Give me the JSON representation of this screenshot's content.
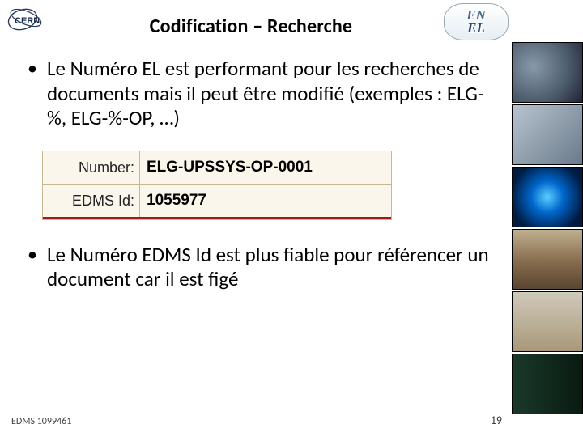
{
  "header": {
    "title": "Codification – Recherche",
    "cern_label": "CERN",
    "en_el": {
      "line1": "EN",
      "line2": "EL"
    }
  },
  "bullets": [
    "Le Numéro EL est performant pour les recherches de documents mais il peut être modifié (exemples : ELG-%, ELG-%-OP, …)",
    "Le Numéro EDMS Id est plus fiable pour référencer un document car il est figé"
  ],
  "record": {
    "rows": [
      {
        "label": "Number:",
        "value": "ELG-UPSSYS-OP-0001"
      },
      {
        "label": "EDMS Id:",
        "value": "1055977"
      }
    ]
  },
  "footer": {
    "left": "EDMS 1099461",
    "page": "19"
  }
}
